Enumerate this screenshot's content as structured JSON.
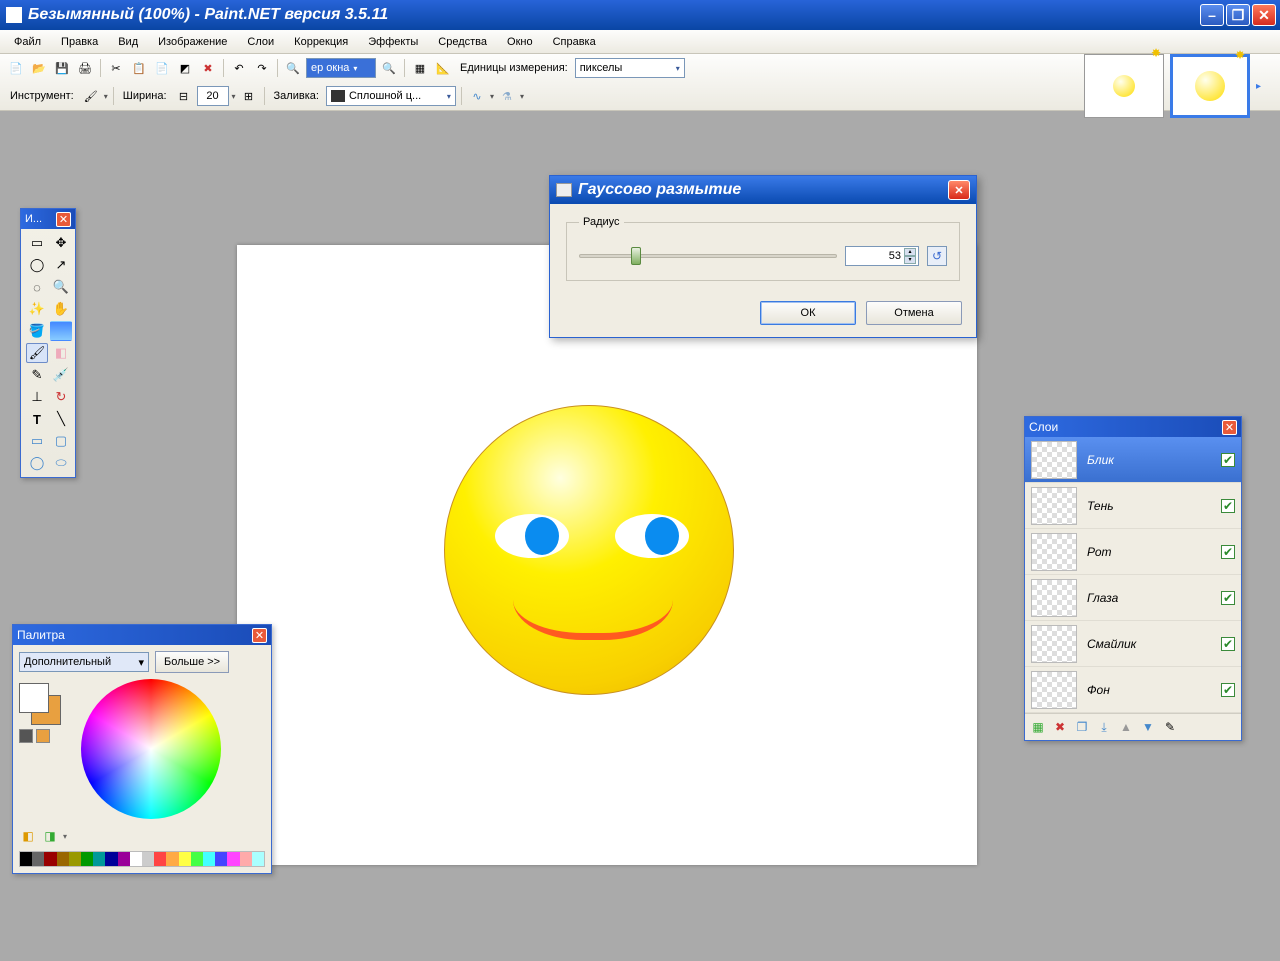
{
  "window": {
    "title": "Безымянный (100%) - Paint.NET версия 3.5.11"
  },
  "menu": {
    "items": [
      "Файл",
      "Правка",
      "Вид",
      "Изображение",
      "Слои",
      "Коррекция",
      "Эффекты",
      "Средства",
      "Окно",
      "Справка"
    ]
  },
  "toolbar": {
    "zoom_value": "ер окна",
    "units_label": "Единицы измерения:",
    "units_value": "пикселы"
  },
  "toolopts": {
    "tool_label": "Инструмент:",
    "width_label": "Ширина:",
    "width_value": "20",
    "fill_label": "Заливка:",
    "fill_value": "Сплошной ц..."
  },
  "tools_panel": {
    "title": "И..."
  },
  "gaussian": {
    "title": "Гауссово размытие",
    "radius_label": "Радиус",
    "radius_value": "53",
    "slider_percent": 20,
    "ok": "ОК",
    "cancel": "Отмена"
  },
  "layers_panel": {
    "title": "Слои",
    "items": [
      {
        "name": "Блик",
        "visible": true,
        "selected": true
      },
      {
        "name": "Тень",
        "visible": true,
        "selected": false
      },
      {
        "name": "Рот",
        "visible": true,
        "selected": false
      },
      {
        "name": "Глаза",
        "visible": true,
        "selected": false
      },
      {
        "name": "Смайлик",
        "visible": true,
        "selected": false
      },
      {
        "name": "Фон",
        "visible": true,
        "selected": false
      }
    ]
  },
  "palette": {
    "title": "Палитра",
    "mode": "Дополнительный",
    "more": "Больше >>",
    "row1": [
      "#000",
      "#666",
      "#900",
      "#960",
      "#990",
      "#090",
      "#099",
      "#009",
      "#909",
      "#fff",
      "#ccc",
      "#f44",
      "#fa4",
      "#ff4",
      "#4f4",
      "#4ff",
      "#44f",
      "#f4f",
      "#faa",
      "#aff"
    ]
  }
}
